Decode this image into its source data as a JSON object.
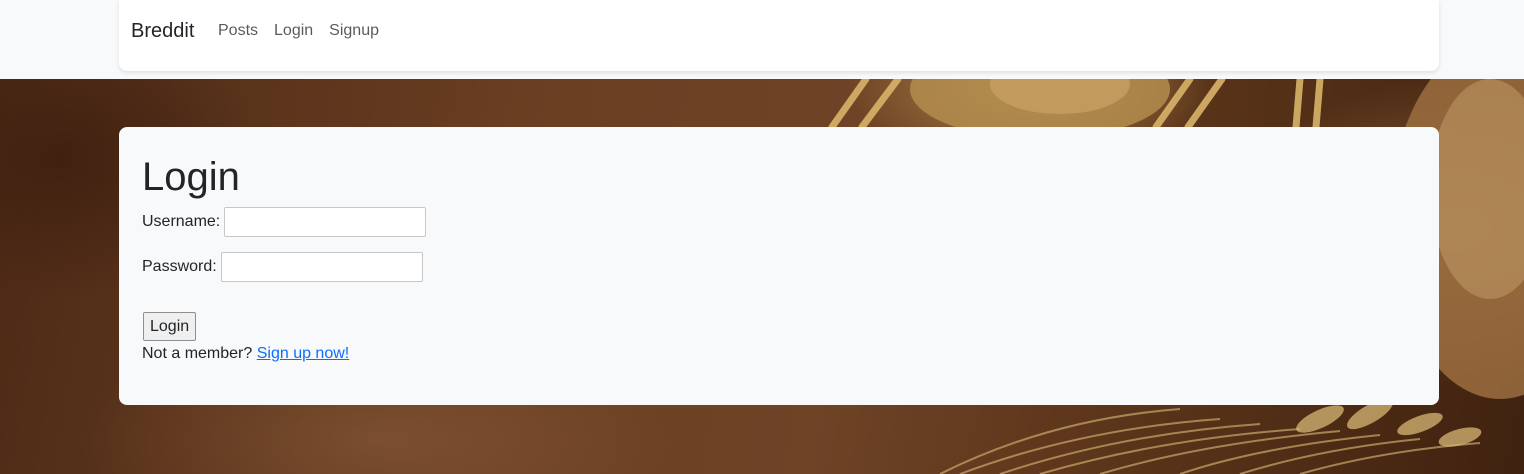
{
  "navbar": {
    "brand": "Breddit",
    "links": [
      {
        "label": "Posts"
      },
      {
        "label": "Login"
      },
      {
        "label": "Signup"
      }
    ]
  },
  "login_card": {
    "title": "Login",
    "username_label": "Username:",
    "username_value": "",
    "password_label": "Password:",
    "password_value": "",
    "submit_label": "Login",
    "signup_prompt": "Not a member?",
    "signup_link": "Sign up now!"
  },
  "colors": {
    "link": "#0d6efd",
    "card_bg": "#f8f9fa",
    "text": "#212529"
  }
}
